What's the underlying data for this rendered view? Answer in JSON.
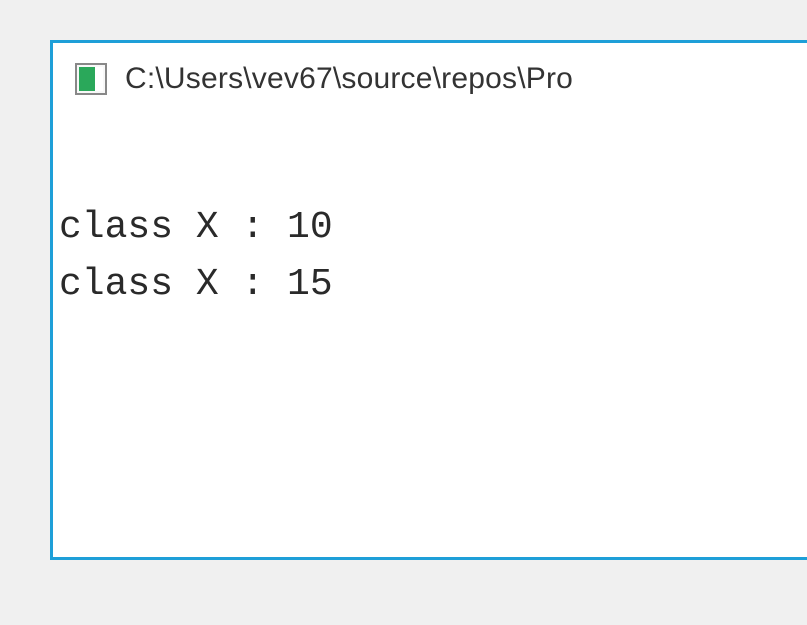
{
  "window": {
    "title": "C:\\Users\\vev67\\source\\repos\\Pro"
  },
  "console": {
    "lines": [
      "class X : 10",
      "class X : 15"
    ]
  }
}
